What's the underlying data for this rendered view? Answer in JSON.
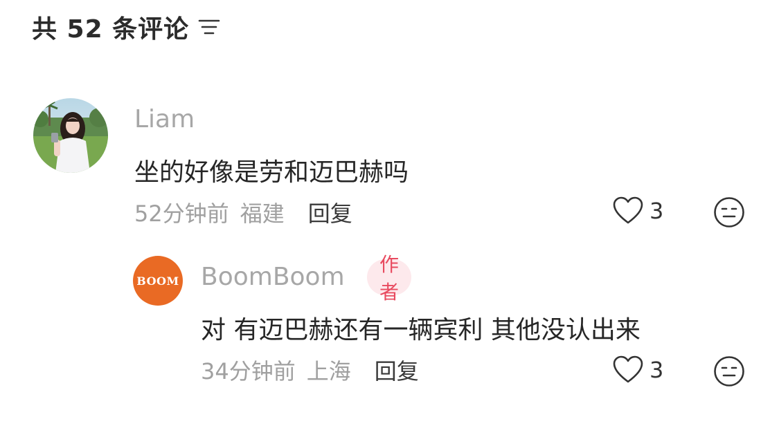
{
  "header": {
    "title": "共 52 条评论",
    "sort_icon": "sort-lines-icon"
  },
  "comments": [
    {
      "username": "Liam",
      "avatar_icon": "user-photo-avatar",
      "content": "坐的好像是劳和迈巴赫吗",
      "time": "52分钟前",
      "location": "福建",
      "reply_label": "回复",
      "like_count": "3",
      "like_icon": "heart-outline-icon",
      "emoji_icon": "neutral-face-icon"
    }
  ],
  "replies": [
    {
      "username": "BoomBoom",
      "avatar_text": "BOOM",
      "avatar_color": "#e96a24",
      "badge": "作者",
      "content": "对 有迈巴赫还有一辆宾利 其他没认出来",
      "time": "34分钟前",
      "location": "上海",
      "reply_label": "回复",
      "like_count": "3",
      "like_icon": "heart-outline-icon",
      "emoji_icon": "neutral-face-icon"
    }
  ],
  "colors": {
    "badge_bg": "#fde9ec",
    "badge_text": "#e84a5f",
    "username": "#a7a7a7",
    "meta": "#a0a0a0"
  }
}
